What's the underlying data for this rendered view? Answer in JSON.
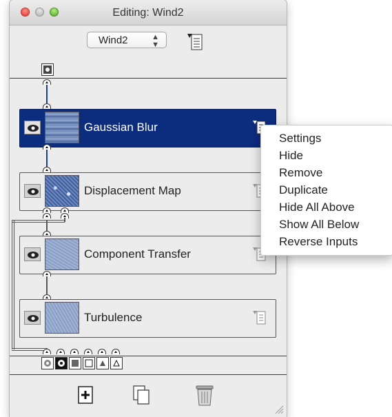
{
  "window": {
    "title": "Editing: Wind2"
  },
  "selector": {
    "value": "Wind2",
    "arrows": "▲▼"
  },
  "nodes": [
    {
      "label": "Gaussian Blur",
      "selected": true
    },
    {
      "label": "Displacement Map",
      "selected": false
    },
    {
      "label": "Component Transfer",
      "selected": false
    },
    {
      "label": "Turbulence",
      "selected": false
    }
  ],
  "context_menu": {
    "items": [
      "Settings",
      "Hide",
      "Remove",
      "Duplicate",
      "Hide All Above",
      "Show All Below",
      "Reverse Inputs"
    ]
  },
  "icons": {
    "node_menu": "node-options-menu-icon",
    "eye": "eye-icon",
    "add": "add-effect-icon",
    "duplicate": "duplicate-icon",
    "trash": "trash-icon"
  },
  "colors": {
    "selected_node": "#0c2c7e",
    "connector_blue": "#1c3c8c"
  }
}
